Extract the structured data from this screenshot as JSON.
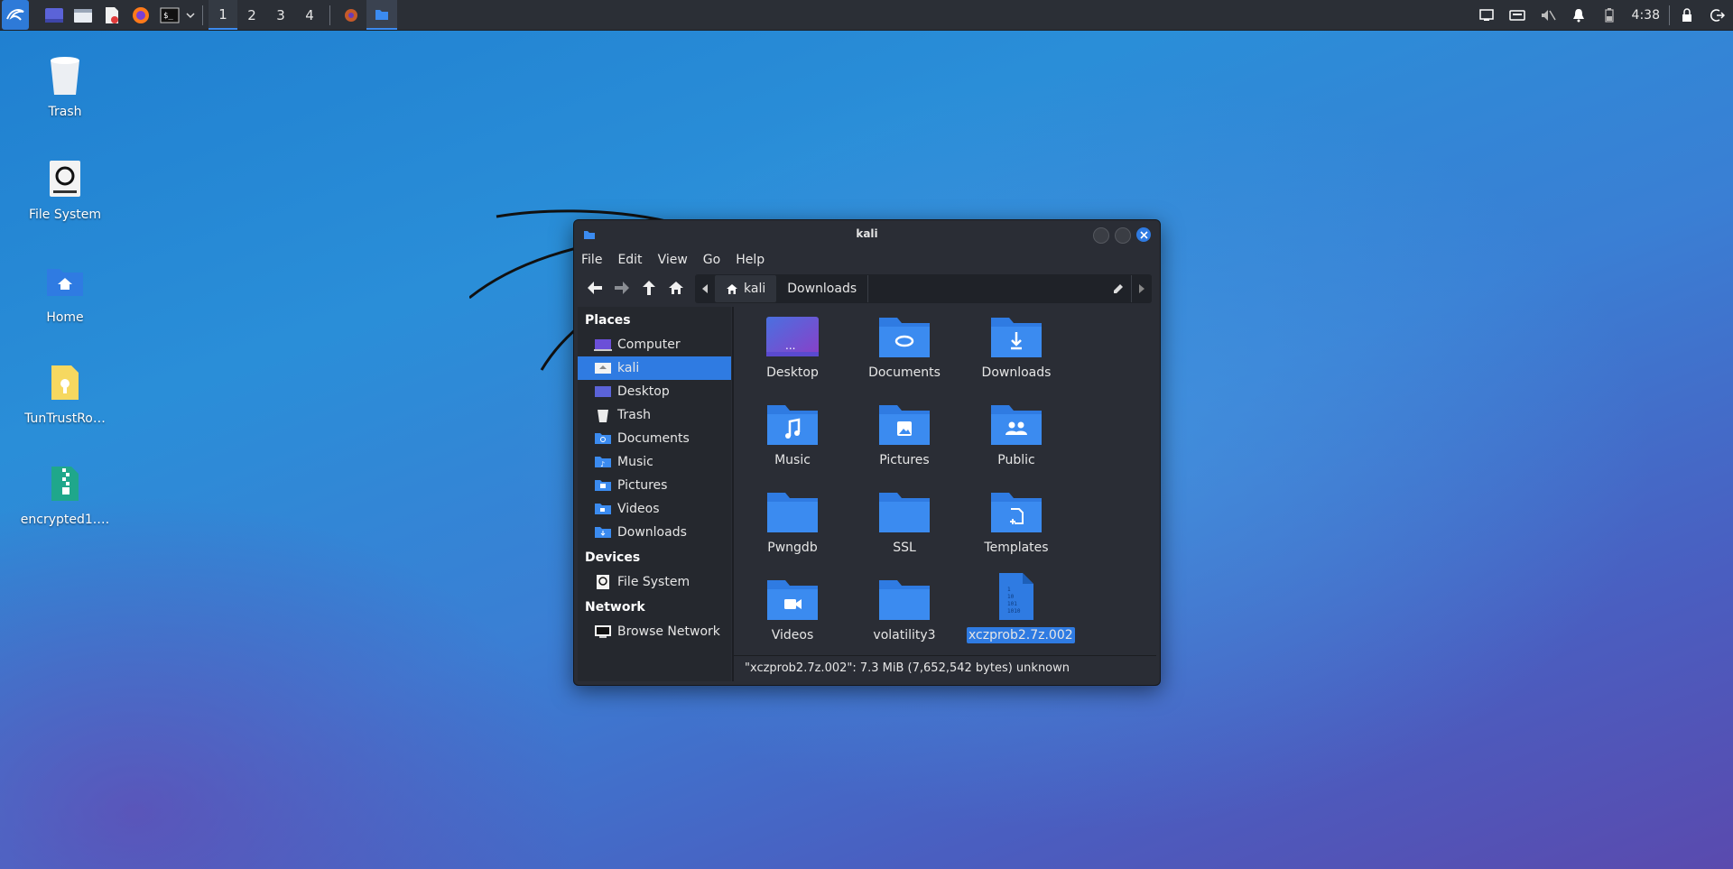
{
  "panel": {
    "workspaces": [
      "1",
      "2",
      "3",
      "4"
    ],
    "active_workspace": "1",
    "clock": "4:38",
    "accent": "#2f7be2"
  },
  "desktop": {
    "icons": [
      {
        "label": "Trash",
        "icon": "trash-icon"
      },
      {
        "label": "File System",
        "icon": "drive-icon"
      },
      {
        "label": "Home",
        "icon": "home-folder-icon"
      },
      {
        "label": "TunTrustRo…",
        "icon": "certificate-file-icon"
      },
      {
        "label": "encrypted1.…",
        "icon": "archive-file-icon"
      }
    ]
  },
  "window": {
    "title": "kali",
    "menu": [
      "File",
      "Edit",
      "View",
      "Go",
      "Help"
    ],
    "path": {
      "home": "kali",
      "current": "Downloads"
    },
    "sidebar": {
      "places_heading": "Places",
      "places": [
        "Computer",
        "kali",
        "Desktop",
        "Trash",
        "Documents",
        "Music",
        "Pictures",
        "Videos",
        "Downloads"
      ],
      "selected": "kali",
      "devices_heading": "Devices",
      "devices": [
        "File System"
      ],
      "network_heading": "Network",
      "network": [
        "Browse Network"
      ]
    },
    "files": [
      {
        "name": "Desktop",
        "icon": "desktop-folder-icon"
      },
      {
        "name": "Documents",
        "icon": "documents-folder-icon"
      },
      {
        "name": "Downloads",
        "icon": "downloads-folder-icon"
      },
      {
        "name": "Music",
        "icon": "music-folder-icon"
      },
      {
        "name": "Pictures",
        "icon": "pictures-folder-icon"
      },
      {
        "name": "Public",
        "icon": "public-folder-icon"
      },
      {
        "name": "Pwngdb",
        "icon": "folder-icon"
      },
      {
        "name": "SSL",
        "icon": "folder-icon"
      },
      {
        "name": "Templates",
        "icon": "templates-folder-icon"
      },
      {
        "name": "Videos",
        "icon": "videos-folder-icon"
      },
      {
        "name": "volatility3",
        "icon": "folder-icon"
      },
      {
        "name": "xczprob2.7z.002",
        "icon": "binary-file-icon",
        "selected": true
      }
    ],
    "status": "\"xczprob2.7z.002\": 7.3 MiB (7,652,542 bytes) unknown"
  }
}
